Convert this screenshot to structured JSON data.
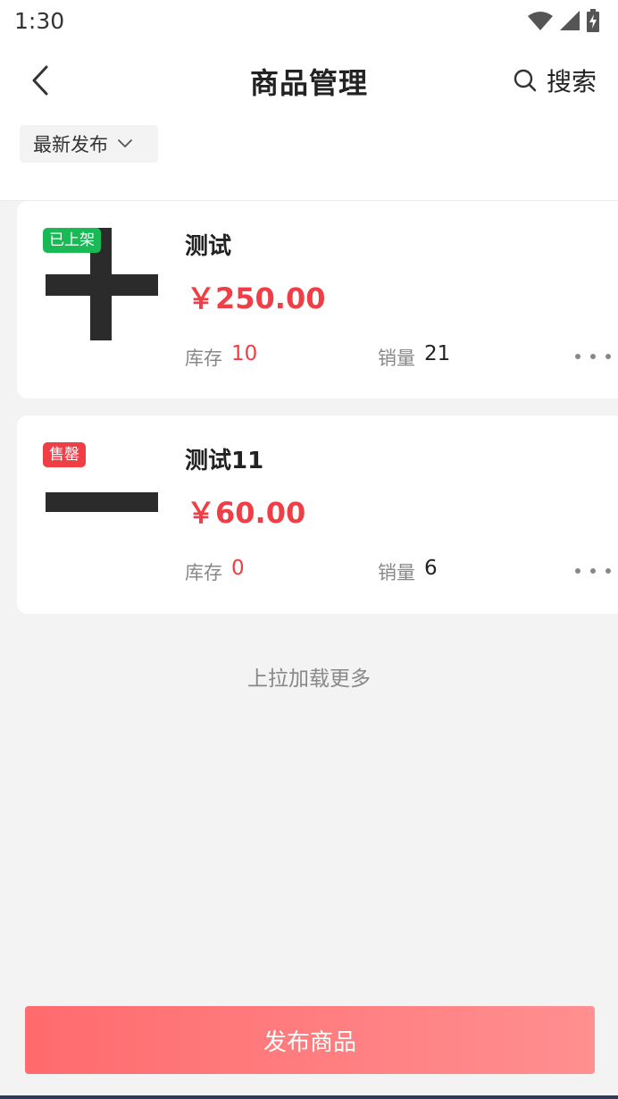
{
  "status_bar": {
    "time": "1:30"
  },
  "nav": {
    "title": "商品管理",
    "search_label": "搜索"
  },
  "filter": {
    "sort_label": "最新发布"
  },
  "products": [
    {
      "status": "已上架",
      "name": "测试",
      "price": "￥250.00",
      "stock_label": "库存",
      "stock": "10",
      "sales_label": "销量",
      "sales": "21"
    },
    {
      "status": "售罄",
      "name": "测试11",
      "price": "￥60.00",
      "stock_label": "库存",
      "stock": "0",
      "sales_label": "销量",
      "sales": "6"
    }
  ],
  "list": {
    "load_more": "上拉加载更多"
  },
  "footer": {
    "publish_label": "发布商品"
  },
  "icons": {
    "back": "chevron-left-icon",
    "search": "search-icon",
    "dropdown": "chevron-down-icon",
    "more": "more-dots-icon",
    "wifi": "wifi-icon",
    "signal": "signal-icon",
    "battery": "battery-charging-icon"
  },
  "colors": {
    "accent": "#ef3e46",
    "badge_listed": "#19b955",
    "badge_soldout": "#ef3e46",
    "publish_gradient_start": "#ff6b6e",
    "publish_gradient_end": "#ff8f90"
  }
}
